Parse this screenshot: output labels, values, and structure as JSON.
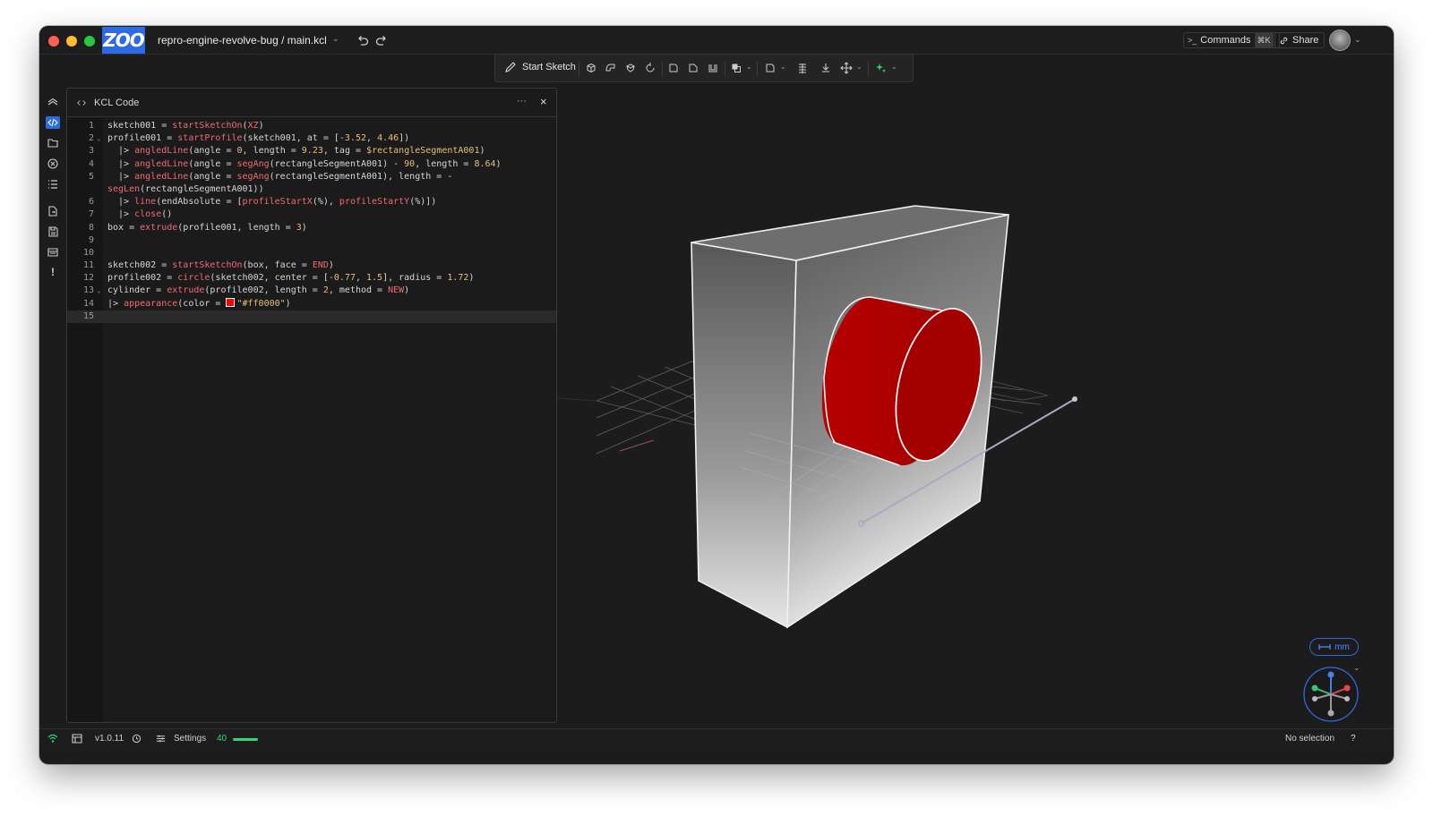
{
  "window": {
    "project_title": "repro-engine-revolve-bug / main.kcl",
    "logo_text": "ZOO",
    "commands_label": "Commands",
    "commands_shortcut": "⌘K",
    "share_label": "Share"
  },
  "toolbar": {
    "start_sketch_label": "Start Sketch",
    "tools": [
      "extrude-icon",
      "sweep-icon",
      "loft-icon",
      "revolve-icon",
      "fillet-icon",
      "chamfer-icon",
      "shell-icon",
      "boolean-icon",
      "plane-icon",
      "helix-icon",
      "insert-icon",
      "transform-icon",
      "text-to-cad-icon"
    ]
  },
  "rail": {
    "icons": [
      "feature-tree-icon",
      "code-icon",
      "files-icon",
      "variables-icon",
      "list-icon",
      "export-icon",
      "save-icon",
      "logs-icon",
      "alert-icon"
    ],
    "active": "code-icon"
  },
  "panel": {
    "title": "KCL Code",
    "more_label": "···",
    "close_label": "×"
  },
  "code": {
    "line_numbers": [
      "1",
      "2",
      "3",
      "4",
      "5",
      "",
      "6",
      "7",
      "8",
      "9",
      "10",
      "11",
      "12",
      "13",
      "14",
      "15"
    ],
    "lines": [
      "sketch001 = startSketchOn(XZ)",
      "profile001 = startProfile(sketch001, at = [-3.52, 4.46])",
      "  |> angledLine(angle = 0, length = 9.23, tag = $rectangleSegmentA001)",
      "  |> angledLine(angle = segAng(rectangleSegmentA001) - 90, length = 8.64)",
      "  |> angledLine(angle = segAng(rectangleSegmentA001), length = -",
      "segLen(rectangleSegmentA001))",
      "  |> line(endAbsolute = [profileStartX(%), profileStartY(%)])",
      "  |> close()",
      "box = extrude(profile001, length = 3)",
      "",
      "",
      "sketch002 = startSketchOn(box, face = END)",
      "profile002 = circle(sketch002, center = [-0.77, 1.5], radius = 1.72)",
      "cylinder = extrude(profile002, length = 2, method = NEW)",
      "|> appearance(color = \"#ff0000\")",
      ""
    ]
  },
  "viewport": {
    "units_label": "mm",
    "cylinder_color": "#ff0000"
  },
  "status": {
    "version": "v1.0.11",
    "settings_label": "Settings",
    "fps": "40",
    "selection": "No selection",
    "help": "?"
  },
  "colors": {
    "accent": "#2d6be4",
    "fps_good": "#2fd47e",
    "syntax_function": "#ef6b73",
    "syntax_literal": "#e5c07b"
  }
}
